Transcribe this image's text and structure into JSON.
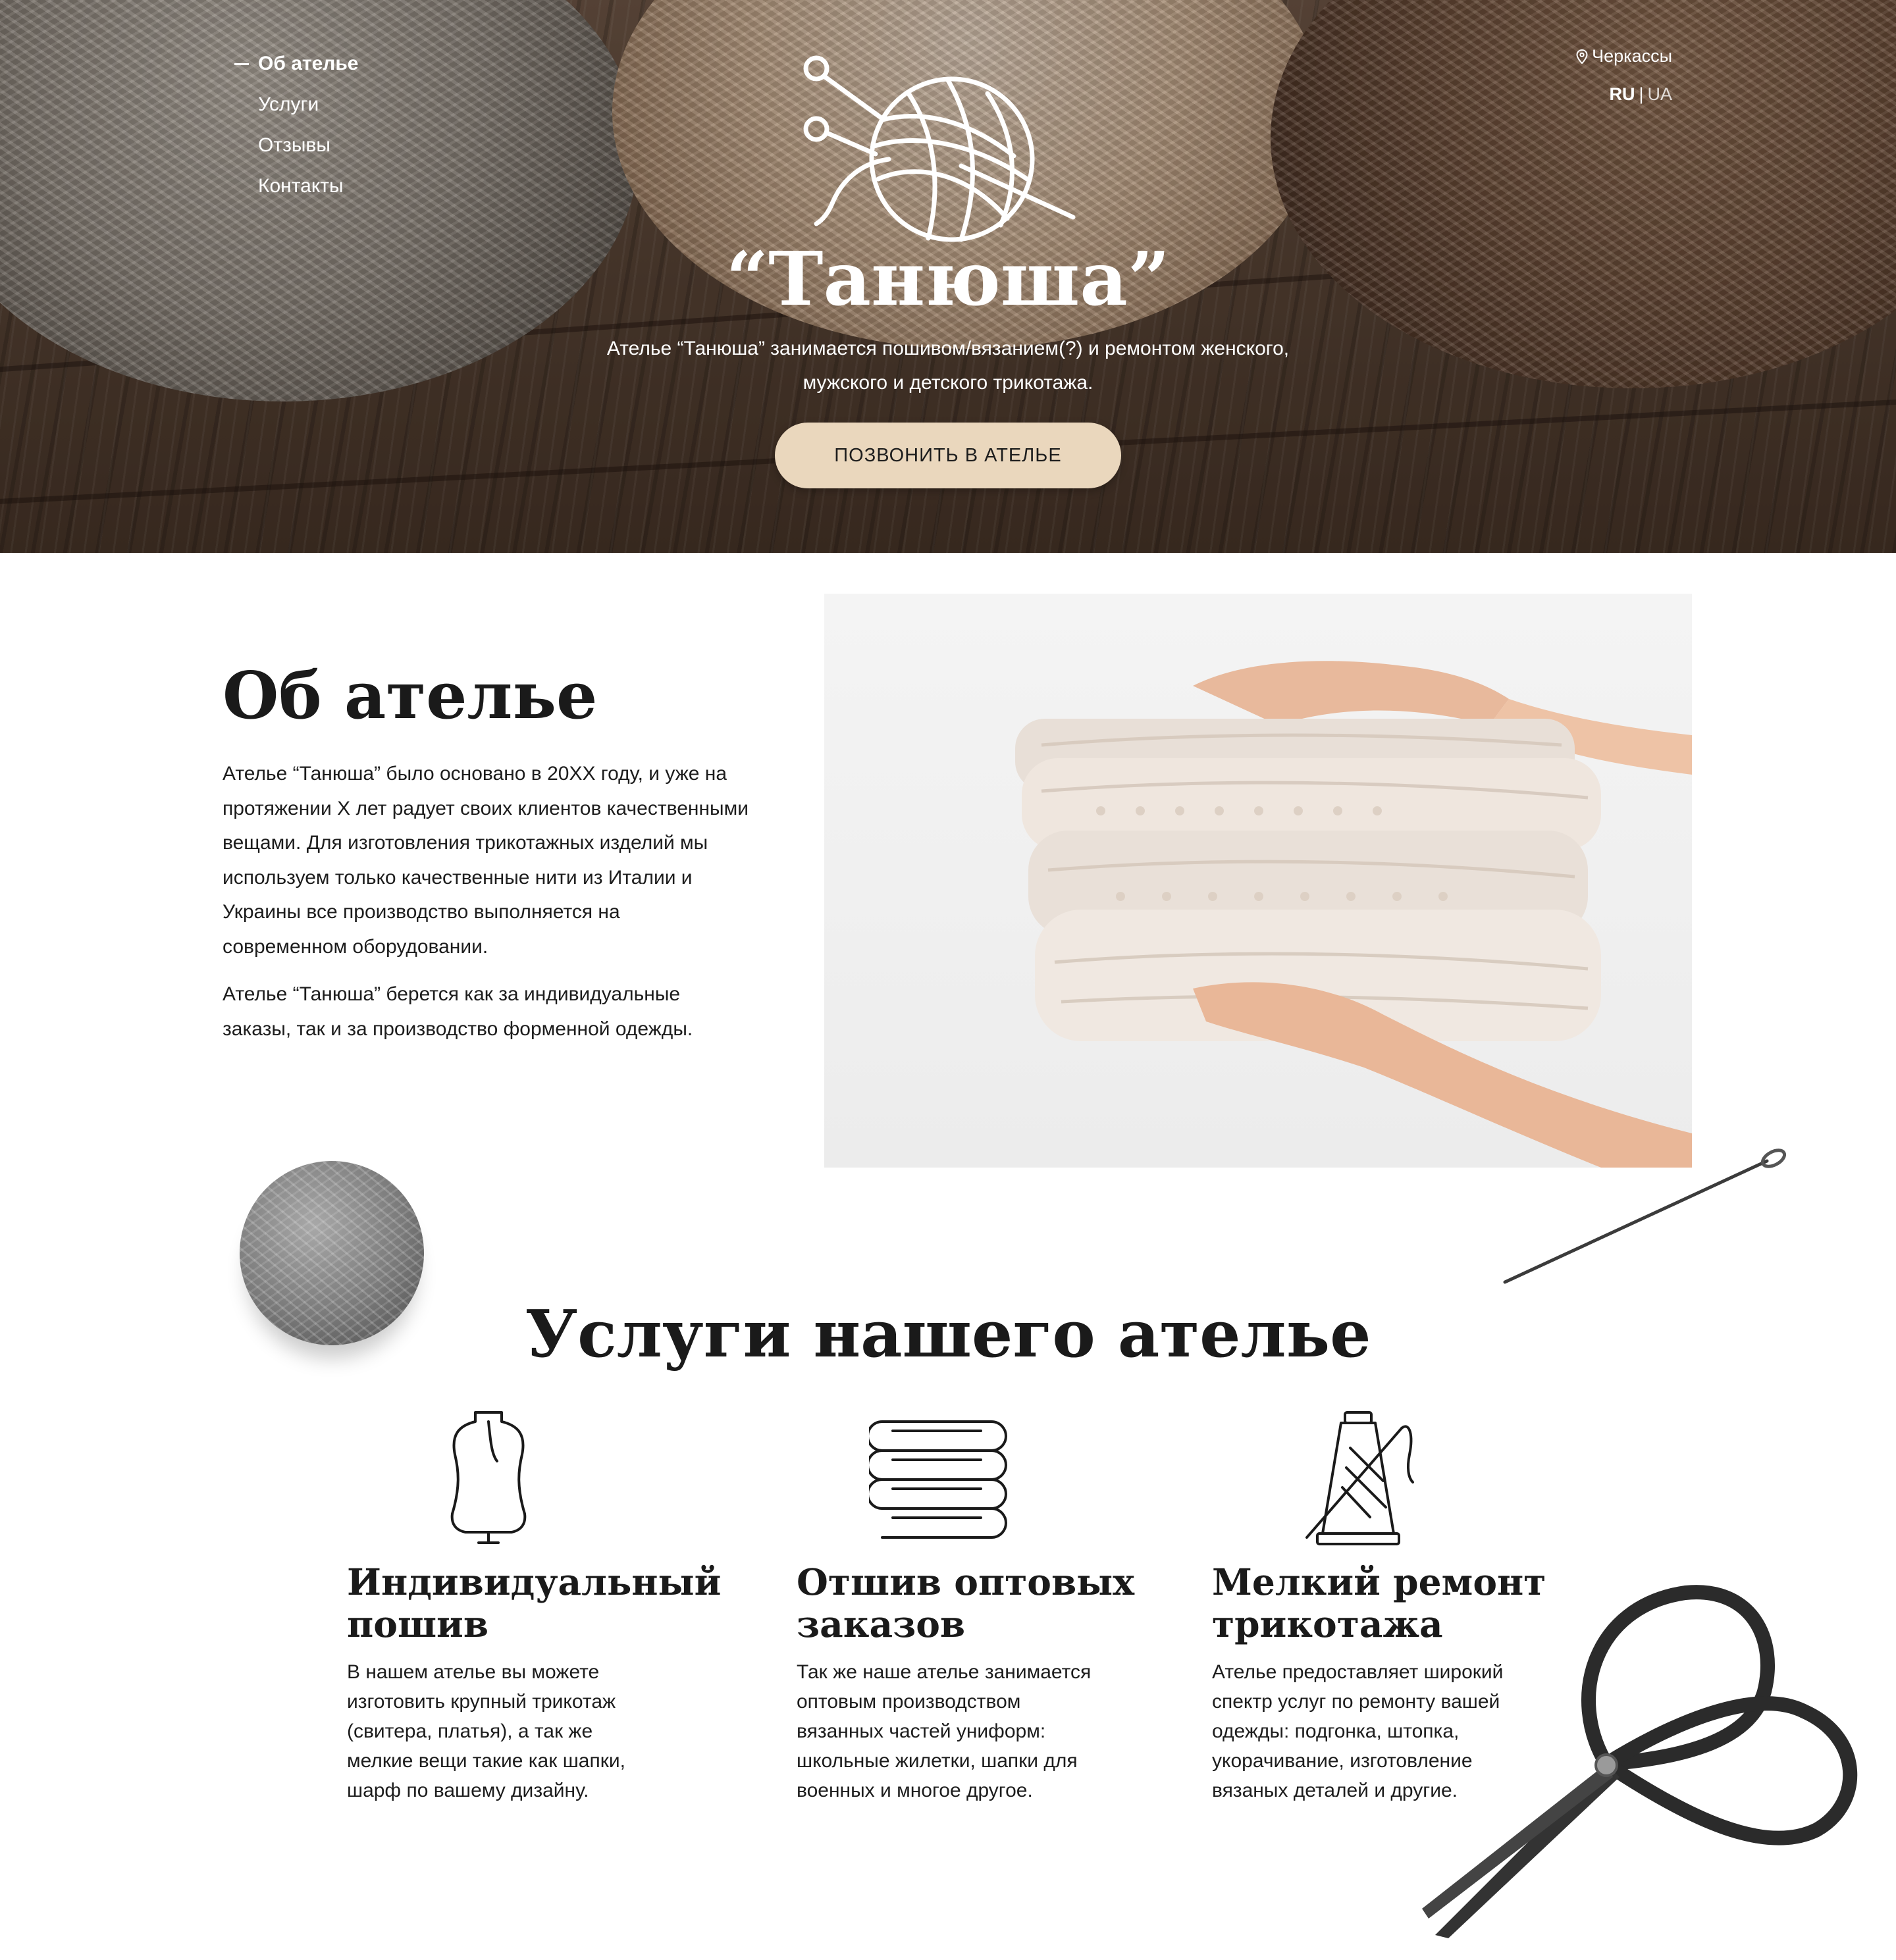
{
  "hero": {
    "nav": [
      {
        "label": "Об ателье",
        "active": true
      },
      {
        "label": "Услуги",
        "active": false
      },
      {
        "label": "Отзывы",
        "active": false
      },
      {
        "label": "Контакты",
        "active": false
      }
    ],
    "location": "Черкассы",
    "languages": {
      "selected": "RU",
      "separator": "|",
      "other": "UA"
    },
    "brand_name": "“Танюша”",
    "description_line1": "Ателье “Танюша” занимается  пошивом/вязанием(?) и ремонтом женского,",
    "description_line2": "мужского и детского трикотажа.",
    "call_button": "ПОЗВОНИТЬ В АТЕЛЬЕ",
    "icons": {
      "location": "map-pin-icon",
      "logo": "yarn-ball-knitting-needles-logo"
    }
  },
  "about": {
    "title": "Об ателье",
    "paragraph1_lines": [
      "Ателье “Танюша” было основано в  20XX году, и уже на",
      "протяжении X лет радует своих клиентов качественными",
      "вещами. Для изготовления трикотажных изделий мы",
      "используем только качественные нити из Италии и",
      "Украины все производство выполняется на",
      "современном оборудовании."
    ],
    "paragraph2_lines": [
      "Ателье “Танюша” берется как за индивидуальные",
      "заказы, так и за производство форменной одежды."
    ]
  },
  "services": {
    "title": "Услуги нашего ателье",
    "items": [
      {
        "icon": "mannequin-icon",
        "title_lines": [
          "Индивидуальный",
          "пошив"
        ],
        "desc_lines": [
          "В нашем ателье вы можете",
          "изготовить крупный трикотаж",
          "(свитера, платья), а так же",
          "мелкие вещи такие как шапки,",
          "шарф по вашему дизайну."
        ]
      },
      {
        "icon": "folded-clothes-stack-icon",
        "title_lines": [
          "Отшив оптовых",
          "заказов"
        ],
        "desc_lines": [
          "Так же наше ателье занимается",
          "оптовым производством",
          "вязанных частей униформ:",
          "школьные жилетки, шапки для",
          "военных и многое другое."
        ]
      },
      {
        "icon": "thread-spool-needle-icon",
        "title_lines": [
          "Мелкий ремонт",
          "трикотажа"
        ],
        "desc_lines": [
          "Ателье предоставляет широкий",
          "спектр услуг по ремонту  вашей",
          "одежды: подгонка,  штопка,",
          "укорачивание,  изготовление",
          "вязаных деталей и другие."
        ]
      }
    ]
  },
  "colors": {
    "button_bg": "#ead7bd",
    "text_dark": "#1a1a1a",
    "white": "#ffffff"
  }
}
